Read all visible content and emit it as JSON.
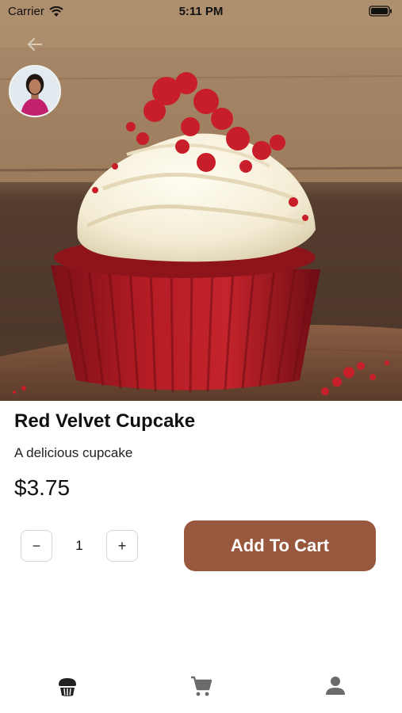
{
  "status_bar": {
    "carrier": "Carrier",
    "time": "5:11 PM"
  },
  "product": {
    "name": "Red Velvet Cupcake",
    "description": "A delicious cupcake",
    "price": "$3.75"
  },
  "quantity": {
    "decrement_label": "−",
    "value": "1",
    "increment_label": "+"
  },
  "add_to_cart_label": "Add To Cart",
  "tab_bar": {
    "items": [
      {
        "icon": "cupcake-icon",
        "active": true
      },
      {
        "icon": "cart-icon",
        "active": false
      },
      {
        "icon": "person-icon",
        "active": false
      }
    ]
  },
  "colors": {
    "accent": "#98583d",
    "active_tab": "#222222",
    "inactive_tab": "#6b6b6b"
  }
}
